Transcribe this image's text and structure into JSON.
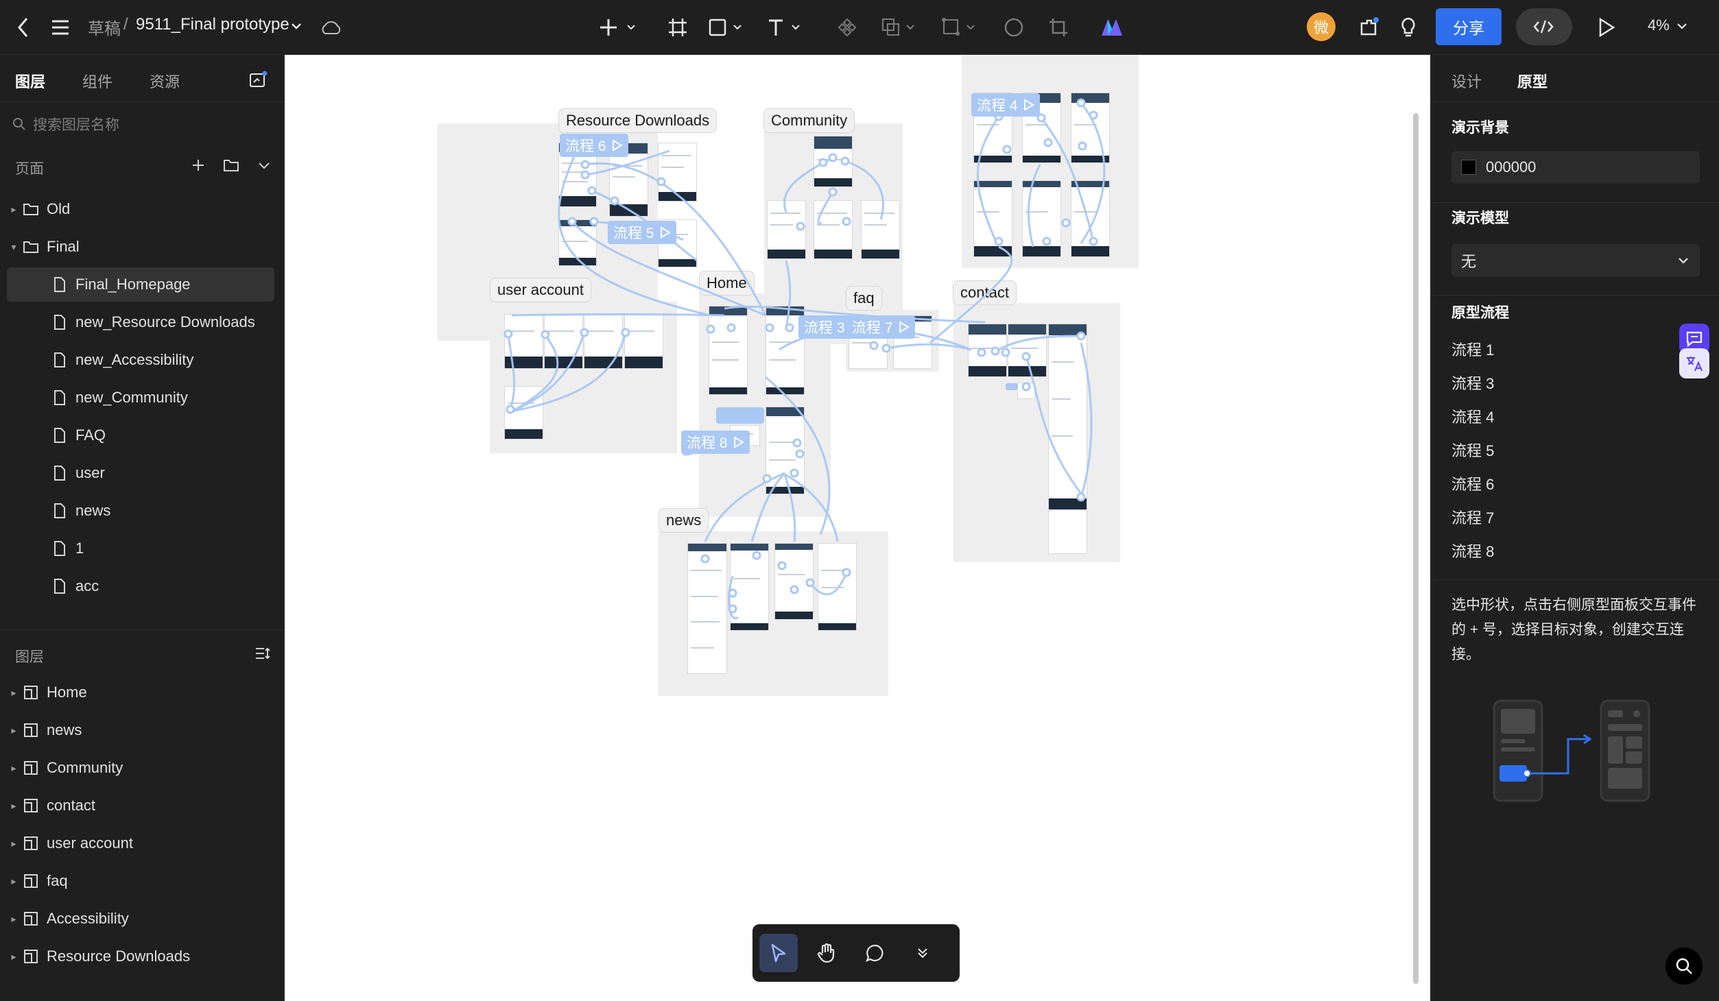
{
  "topbar": {
    "breadcrumb_root": "草稿",
    "separator": "/",
    "file_name": "9511_Final prototype",
    "avatar_initial": "微",
    "share_label": "分享",
    "zoom": "4%"
  },
  "left_panel": {
    "tabs": [
      "图层",
      "组件",
      "资源"
    ],
    "active_tab": "图层",
    "search_placeholder": "搜索图层名称",
    "pages_title": "页面",
    "pages": [
      {
        "label": "Old",
        "type": "folder",
        "expanded": false
      },
      {
        "label": "Final",
        "type": "folder",
        "expanded": true
      },
      {
        "label": "Final_Homepage",
        "type": "page",
        "selected": true
      },
      {
        "label": "new_Resource Downloads",
        "type": "page"
      },
      {
        "label": "new_Accessibility",
        "type": "page"
      },
      {
        "label": "new_Community",
        "type": "page"
      },
      {
        "label": "FAQ",
        "type": "page"
      },
      {
        "label": "user",
        "type": "page"
      },
      {
        "label": "news",
        "type": "page"
      },
      {
        "label": "1",
        "type": "page"
      },
      {
        "label": "acc",
        "type": "page"
      }
    ],
    "layers_title": "图层",
    "layers": [
      "Home",
      "news",
      "Community",
      "contact",
      "user account",
      "faq",
      "Accessibility",
      "Resource Downloads"
    ]
  },
  "right_panel": {
    "tabs": [
      "设计",
      "原型"
    ],
    "active_tab": "原型",
    "bg_title": "演示背景",
    "bg_color_value": "000000",
    "model_title": "演示模型",
    "model_value": "无",
    "flows_title": "原型流程",
    "flows": [
      "流程 1",
      "流程 3",
      "流程 4",
      "流程 5",
      "流程 6",
      "流程 7",
      "流程 8"
    ],
    "hint": "选中形状，点击右侧原型面板交互事件的 + 号，选择目标对象，创建交互连接。"
  },
  "canvas": {
    "section_labels": {
      "resource": "Resource Downloads",
      "community": "Community",
      "user": "user account",
      "home": "Home",
      "faq": "faq",
      "contact": "contact",
      "news": "news"
    },
    "flow_tags": {
      "f6": "流程 6",
      "f5": "流程 5",
      "f4": "流程 4",
      "f3": "流程 3",
      "f7": "流程 7",
      "f8": "流程 8"
    }
  },
  "colors": {
    "accent": "#2f6fed",
    "panel_bg": "#1f1f1f",
    "canvas_section": "#eeeeee",
    "link_line": "#a9c8f4"
  }
}
